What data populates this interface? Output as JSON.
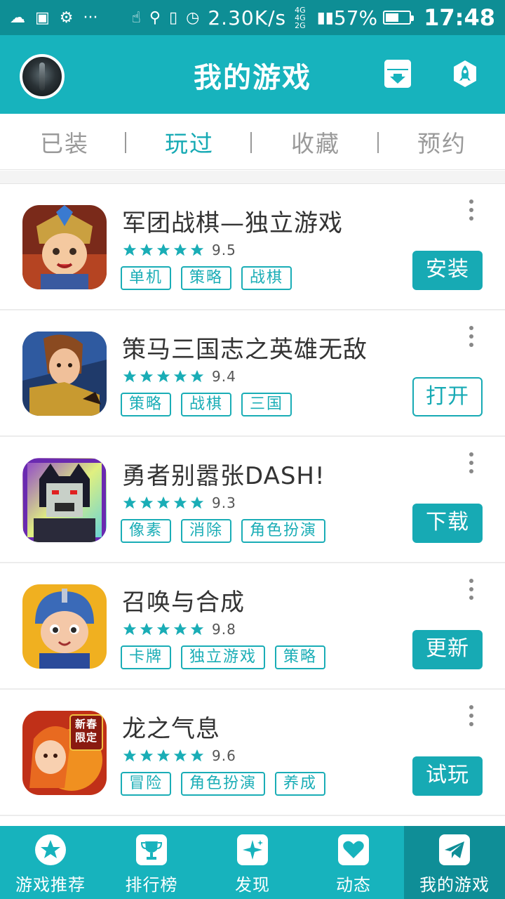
{
  "status_bar": {
    "speed": "2.30K/s",
    "network_top": "4G 4G",
    "network_bottom": "2G",
    "battery": "57%",
    "battery_level": 0.57,
    "time": "17:48"
  },
  "header": {
    "title": "我的游戏",
    "icons": [
      "avatar",
      "download-box-icon",
      "rocket-icon"
    ]
  },
  "tabs": [
    {
      "label": "已装",
      "active": false
    },
    {
      "label": "玩过",
      "active": true
    },
    {
      "label": "收藏",
      "active": false
    },
    {
      "label": "预约",
      "active": false
    }
  ],
  "games": [
    {
      "name": "军团战棋—独立游戏",
      "rating": "9.5",
      "stars": 5,
      "tags": [
        "单机",
        "策略",
        "战棋"
      ],
      "action": "安装",
      "action_style": "solid"
    },
    {
      "name": "策马三国志之英雄无敌",
      "rating": "9.4",
      "stars": 5,
      "tags": [
        "策略",
        "战棋",
        "三国"
      ],
      "action": "打开",
      "action_style": "outline"
    },
    {
      "name": "勇者别嚣张DASH!",
      "rating": "9.3",
      "stars": 5,
      "tags": [
        "像素",
        "消除",
        "角色扮演"
      ],
      "action": "下载",
      "action_style": "solid"
    },
    {
      "name": "召唤与合成",
      "rating": "9.8",
      "stars": 5,
      "tags": [
        "卡牌",
        "独立游戏",
        "策略"
      ],
      "action": "更新",
      "action_style": "solid"
    },
    {
      "name": "龙之气息",
      "rating": "9.6",
      "stars": 5,
      "tags": [
        "冒险",
        "角色扮演",
        "养成"
      ],
      "action": "试玩",
      "action_style": "solid",
      "icon_badge": "新春限定"
    }
  ],
  "bottom_nav": [
    {
      "label": "游戏推荐",
      "icon": "star-icon",
      "active": false
    },
    {
      "label": "排行榜",
      "icon": "trophy-icon",
      "active": false
    },
    {
      "label": "发现",
      "icon": "sparkle-icon",
      "active": false
    },
    {
      "label": "动态",
      "icon": "heart-icon",
      "active": false
    },
    {
      "label": "我的游戏",
      "icon": "paper-plane-icon",
      "active": true
    }
  ],
  "colors": {
    "header": "#17b3bd",
    "status_bar": "#0e8e95",
    "accent": "#17aab4",
    "nav_active": "#0f8e97"
  }
}
